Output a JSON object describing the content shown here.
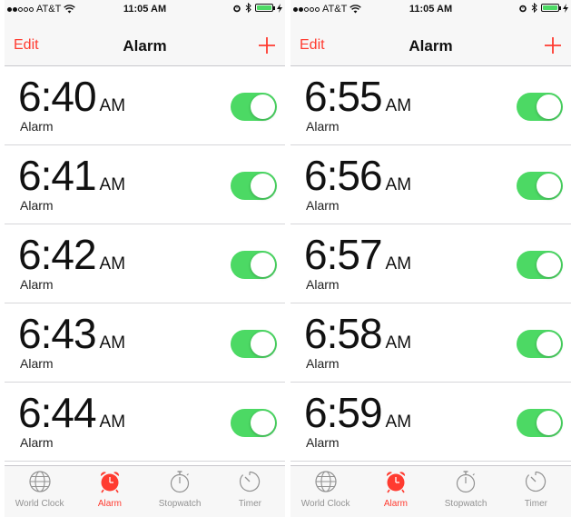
{
  "colors": {
    "accent": "#ff3b30",
    "toggle_on": "#4cd964",
    "tab_inactive": "#929292"
  },
  "screens": [
    {
      "status": {
        "carrier": "AT&T",
        "time": "11:05 AM"
      },
      "nav": {
        "edit_label": "Edit",
        "title": "Alarm",
        "add_icon": "plus-icon"
      },
      "alarms": [
        {
          "time": "6:40",
          "ampm": "AM",
          "label": "Alarm",
          "enabled": true
        },
        {
          "time": "6:41",
          "ampm": "AM",
          "label": "Alarm",
          "enabled": true
        },
        {
          "time": "6:42",
          "ampm": "AM",
          "label": "Alarm",
          "enabled": true
        },
        {
          "time": "6:43",
          "ampm": "AM",
          "label": "Alarm",
          "enabled": true
        },
        {
          "time": "6:44",
          "ampm": "AM",
          "label": "Alarm",
          "enabled": true
        }
      ],
      "tabs": [
        {
          "label": "World Clock",
          "icon": "globe-icon",
          "active": false
        },
        {
          "label": "Alarm",
          "icon": "alarm-clock-icon",
          "active": true
        },
        {
          "label": "Stopwatch",
          "icon": "stopwatch-icon",
          "active": false
        },
        {
          "label": "Timer",
          "icon": "timer-icon",
          "active": false
        }
      ]
    },
    {
      "status": {
        "carrier": "AT&T",
        "time": "11:05 AM"
      },
      "nav": {
        "edit_label": "Edit",
        "title": "Alarm",
        "add_icon": "plus-icon"
      },
      "alarms": [
        {
          "time": "6:55",
          "ampm": "AM",
          "label": "Alarm",
          "enabled": true
        },
        {
          "time": "6:56",
          "ampm": "AM",
          "label": "Alarm",
          "enabled": true
        },
        {
          "time": "6:57",
          "ampm": "AM",
          "label": "Alarm",
          "enabled": true
        },
        {
          "time": "6:58",
          "ampm": "AM",
          "label": "Alarm",
          "enabled": true
        },
        {
          "time": "6:59",
          "ampm": "AM",
          "label": "Alarm",
          "enabled": true
        }
      ],
      "tabs": [
        {
          "label": "World Clock",
          "icon": "globe-icon",
          "active": false
        },
        {
          "label": "Alarm",
          "icon": "alarm-clock-icon",
          "active": true
        },
        {
          "label": "Stopwatch",
          "icon": "stopwatch-icon",
          "active": false
        },
        {
          "label": "Timer",
          "icon": "timer-icon",
          "active": false
        }
      ]
    }
  ]
}
